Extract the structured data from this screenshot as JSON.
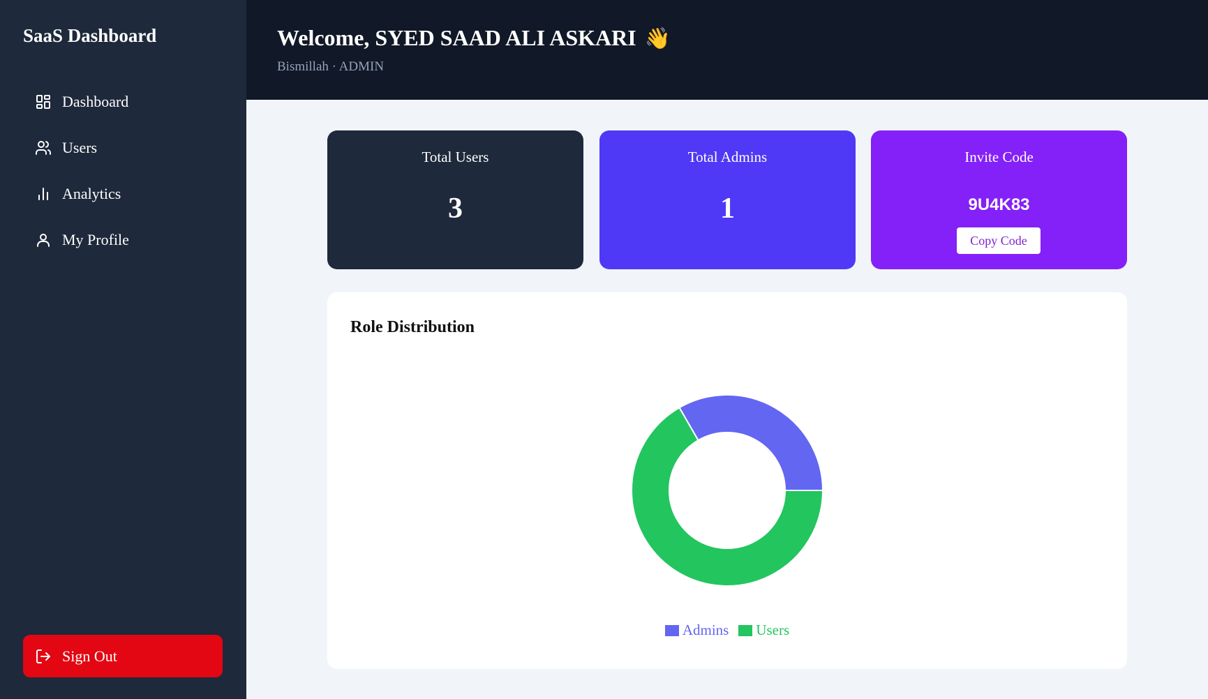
{
  "sidebar": {
    "brand": "SaaS Dashboard",
    "items": [
      {
        "label": "Dashboard",
        "icon": "dashboard-grid-icon"
      },
      {
        "label": "Users",
        "icon": "users-icon"
      },
      {
        "label": "Analytics",
        "icon": "bar-chart-icon"
      },
      {
        "label": "My Profile",
        "icon": "user-icon"
      }
    ],
    "signout_label": "Sign Out"
  },
  "header": {
    "welcome": "Welcome, SYED SAAD ALI ASKARI",
    "wave": "👋",
    "subtitle": "Bismillah · ADMIN"
  },
  "cards": {
    "total_users": {
      "title": "Total Users",
      "value": "3"
    },
    "total_admins": {
      "title": "Total Admins",
      "value": "1"
    },
    "invite": {
      "title": "Invite Code",
      "code": "9U4K83",
      "copy_label": "Copy Code"
    }
  },
  "colors": {
    "sidebar_bg": "#1e293b",
    "header_bg": "#111827",
    "signout_bg": "#e30613",
    "admins": "#6366f1",
    "users": "#22c55e"
  },
  "chart_data": {
    "type": "pie",
    "title": "Role Distribution",
    "categories": [
      "Admins",
      "Users"
    ],
    "values": [
      1,
      2
    ],
    "colors": [
      "#6366f1",
      "#22c55e"
    ],
    "legend": "bottom"
  }
}
